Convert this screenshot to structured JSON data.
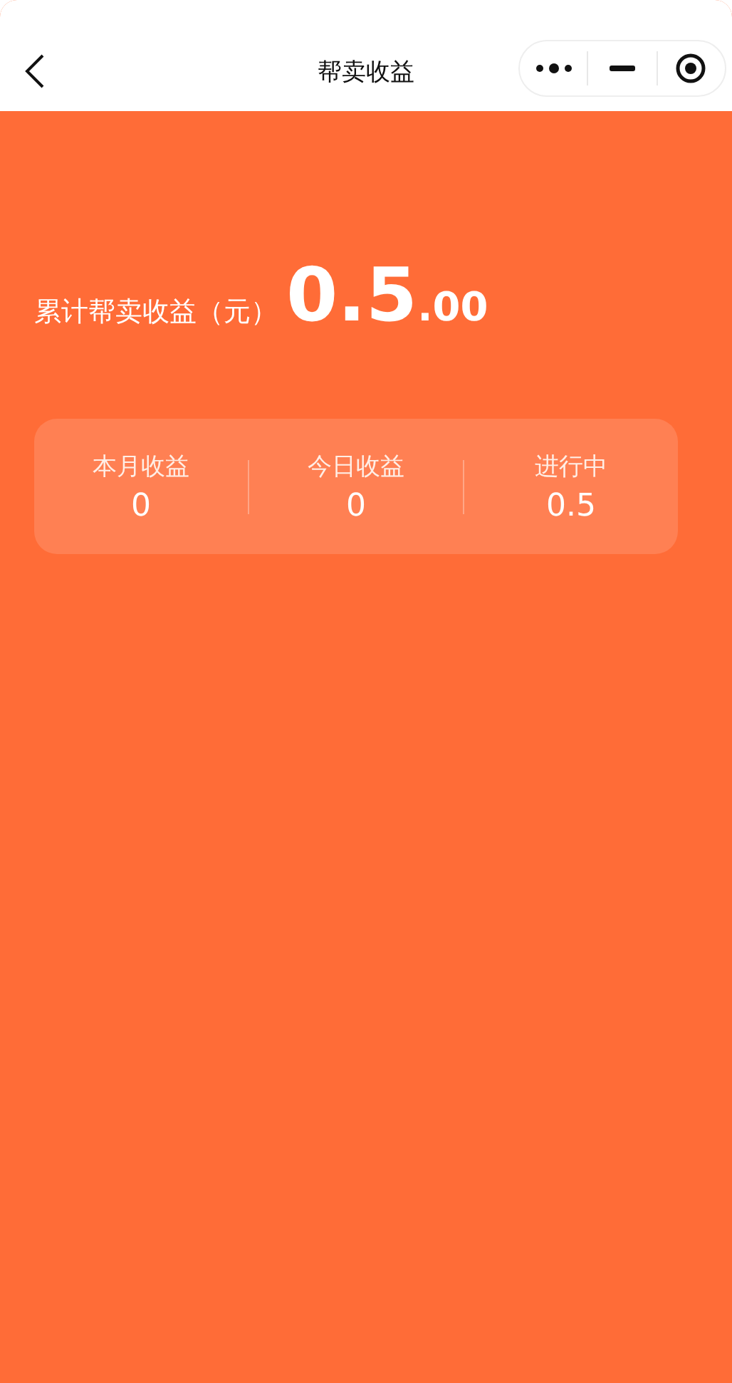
{
  "nav": {
    "title": "帮卖收益"
  },
  "summary": {
    "label": "累计帮卖收益（元）",
    "amount_main": "0.5",
    "amount_decimal": ".00"
  },
  "stats": [
    {
      "label": "本月收益",
      "value": "0"
    },
    {
      "label": "今日收益",
      "value": "0"
    },
    {
      "label": "进行中",
      "value": "0.5"
    }
  ]
}
